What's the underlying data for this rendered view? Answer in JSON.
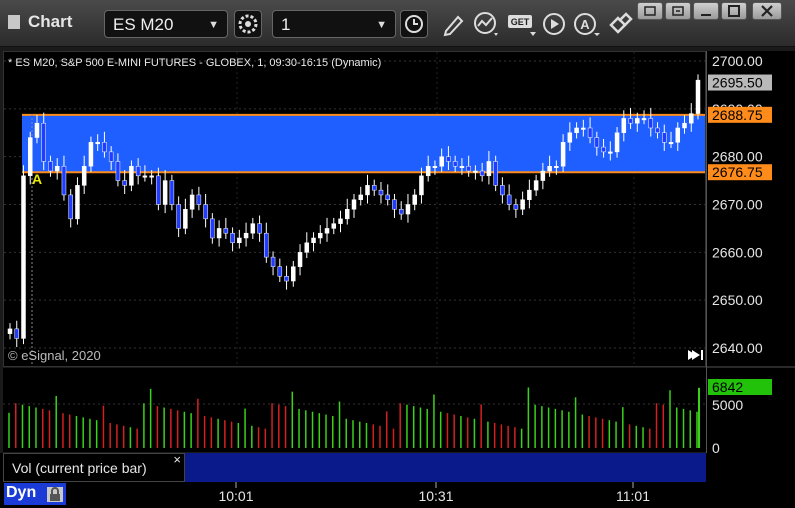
{
  "window": {
    "title": "Chart",
    "symbol": "ES M20",
    "interval": "1"
  },
  "chart": {
    "header": "* ES M20, S&P 500 E-MINI FUTURES - GLOBEX, 1, 09:30-16:15 (Dynamic)",
    "copyright": "© eSignal, 2020",
    "marker_label": "A",
    "price_ticks": [
      "2700.00",
      "2690.00",
      "2680.00",
      "2670.00",
      "2660.00",
      "2650.00",
      "2640.00"
    ],
    "last_price": "2695.50",
    "zone_upper": "2688.75",
    "zone_lower": "2676.75",
    "volume_ticks": [
      "5000",
      "0"
    ],
    "volume_last": "6842",
    "study_label": "Vol (current price bar)",
    "study_close": "×",
    "time_labels": [
      "10:01",
      "10:31",
      "11:01"
    ],
    "mode_label": "Dyn"
  },
  "chart_data": {
    "type": "candlestick",
    "title": "* ES M20, S&P 500 E-MINI FUTURES - GLOBEX, 1, 09:30-16:15 (Dynamic)",
    "ylim": [
      2638,
      2703
    ],
    "x": [
      "10:01",
      "10:31",
      "11:01"
    ],
    "price_closes": [
      2644,
      2642,
      2676,
      2684,
      2687,
      2679,
      2677,
      2678,
      2672,
      2667,
      2674,
      2678,
      2683,
      2683,
      2681,
      2679,
      2675,
      2674,
      2678,
      2676,
      2676,
      2676,
      2670,
      2675,
      2670,
      2665,
      2669,
      2672,
      2670,
      2667,
      2663,
      2665,
      2664,
      2662,
      2663,
      2664,
      2666,
      2664,
      2659,
      2657,
      2655,
      2654,
      2657,
      2660,
      2662,
      2663,
      2664,
      2665,
      2666,
      2667,
      2669,
      2671,
      2672,
      2674,
      2673,
      2672,
      2671,
      2669,
      2668,
      2670,
      2672,
      2676,
      2678,
      2678,
      2680,
      2679,
      2678,
      2678,
      2677,
      2677,
      2676,
      2679,
      2674,
      2672,
      2670,
      2669,
      2671,
      2673,
      2675,
      2677,
      2678,
      2678,
      2683,
      2685,
      2686,
      2686,
      2684,
      2682,
      2681,
      2681,
      2685,
      2688,
      2687,
      2688,
      2688,
      2686,
      2685,
      2683,
      2683,
      2686,
      2687,
      2689,
      2696
    ],
    "zones": [
      {
        "label": "2688.75",
        "value": 2688.75
      },
      {
        "label": "2676.75",
        "value": 2676.75
      }
    ],
    "last_price": 2695.5,
    "volume_ylim": [
      0,
      9000
    ],
    "volume_last": 6842
  }
}
